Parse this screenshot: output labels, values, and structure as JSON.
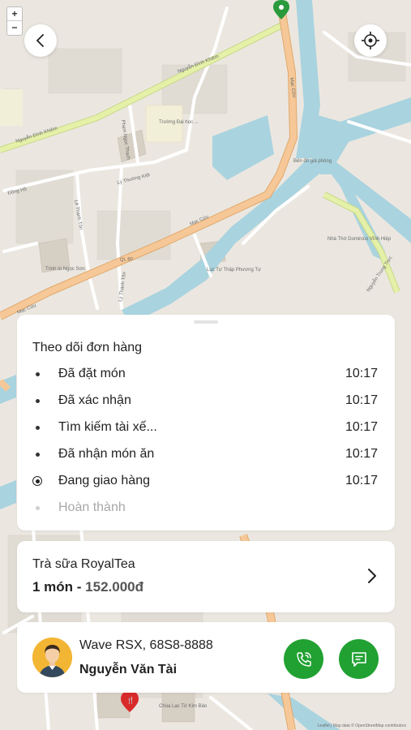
{
  "map": {
    "streets": [
      "Nguyễn Đình Khiêm",
      "Nguyễn Đình Khiêm",
      "Mạc Cửu",
      "Mạc Cửu",
      "Mạc Cửu",
      "Phạm Ngọc Thạch",
      "Lý Thường Kiệt",
      "Đồng Hồ",
      "Lê Thánh Tôn",
      "Lý Thánh Tôn",
      "QL 80",
      "Nguyễn Trung Trực"
    ],
    "places": [
      "Trường Đại học ...",
      "Bến đò giá phòng",
      "Nhà Thờ Dominico Vĩnh Hiệp",
      "Trinh tú Ngọc Sơn",
      "Lục Tự Thập Phương Tự",
      "Chùa Lạc Từ Kim Bảo"
    ],
    "attribution": "Leaflet | Map data © OpenStreetMap contributors",
    "zoom_in": "+",
    "zoom_out": "−"
  },
  "tracking": {
    "title": "Theo dõi đơn hàng",
    "steps": [
      {
        "label": "Đã đặt món",
        "time": "10:17",
        "state": "done"
      },
      {
        "label": "Đã xác nhận",
        "time": "10:17",
        "state": "done"
      },
      {
        "label": "Tìm kiếm tài xế...",
        "time": "10:17",
        "state": "done"
      },
      {
        "label": "Đã nhận món ăn",
        "time": "10:17",
        "state": "done"
      },
      {
        "label": "Đang giao hàng",
        "time": "10:17",
        "state": "current"
      },
      {
        "label": "Hoàn thành",
        "time": "",
        "state": "pending"
      }
    ]
  },
  "order": {
    "shop": "Trà sữa RoyalTea",
    "count": "1 món - ",
    "price": "152.000đ"
  },
  "driver": {
    "vehicle": "Wave RSX, 68S8-8888",
    "name": "Nguyễn Văn Tài"
  },
  "colors": {
    "accent": "#21a132",
    "road_major": "#f6c898",
    "road_green": "#e5f0a8",
    "water": "#a9d3df",
    "land": "#ebe7e0"
  },
  "icons": [
    "back-arrow-icon",
    "locate-crosshair-icon",
    "chevron-right-icon",
    "phone-icon",
    "chat-icon",
    "location-pin-icon",
    "restaurant-pin-icon"
  ]
}
